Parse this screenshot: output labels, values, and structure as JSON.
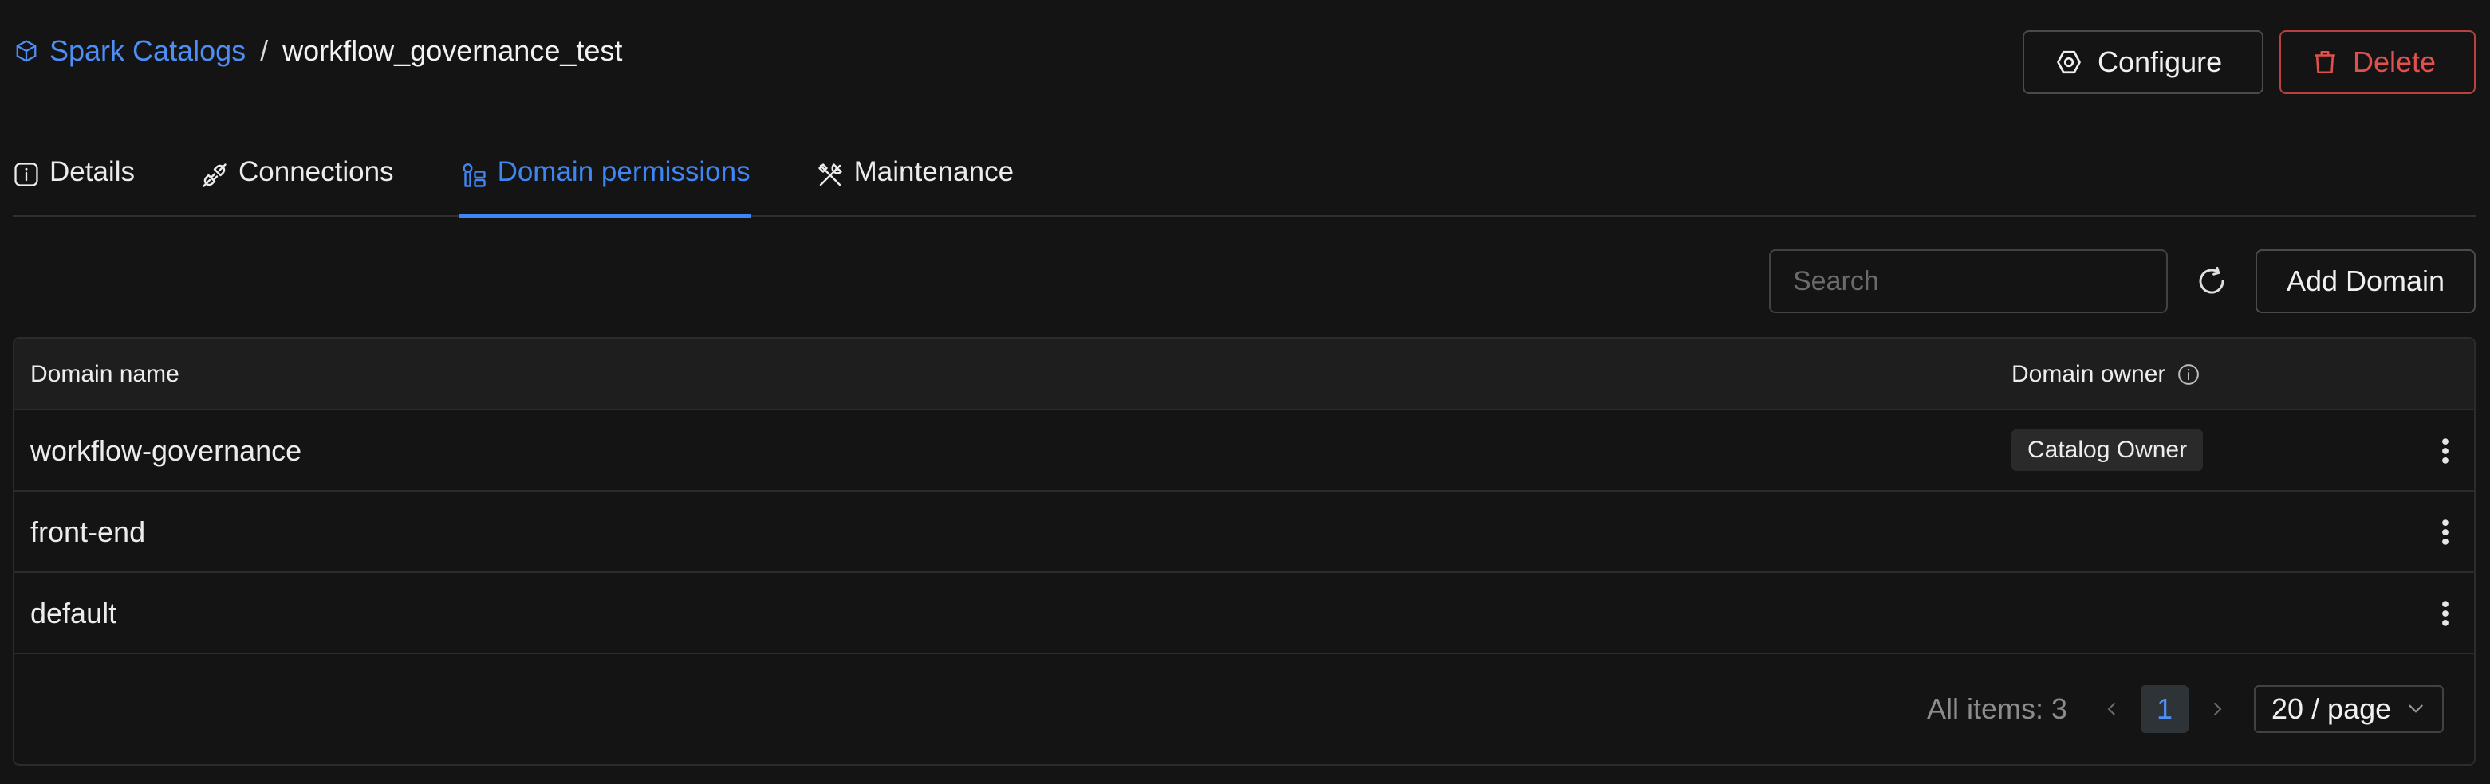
{
  "breadcrumb": {
    "parent": "Spark Catalogs",
    "separator": "/",
    "current": "workflow_governance_test",
    "parent_icon": "cube-icon"
  },
  "header_actions": {
    "configure_label": "Configure",
    "delete_label": "Delete"
  },
  "tabs": [
    {
      "label": "Details",
      "icon": "info-icon",
      "active": false
    },
    {
      "label": "Connections",
      "icon": "plug-icon",
      "active": false
    },
    {
      "label": "Domain permissions",
      "icon": "domain-permissions-icon",
      "active": true
    },
    {
      "label": "Maintenance",
      "icon": "tools-icon",
      "active": false
    }
  ],
  "toolbar": {
    "search_placeholder": "Search",
    "add_label": "Add Domain"
  },
  "table": {
    "columns": [
      "Domain name",
      "Domain owner"
    ],
    "rows": [
      {
        "name": "workflow-governance",
        "owner": "Catalog Owner"
      },
      {
        "name": "front-end",
        "owner": ""
      },
      {
        "name": "default",
        "owner": ""
      }
    ]
  },
  "pagination": {
    "total_label": "All items: 3",
    "current_page": "1",
    "page_size": "20 / page"
  },
  "colors": {
    "accent": "#3f86f5",
    "danger": "#e0504e",
    "background": "#141414"
  }
}
